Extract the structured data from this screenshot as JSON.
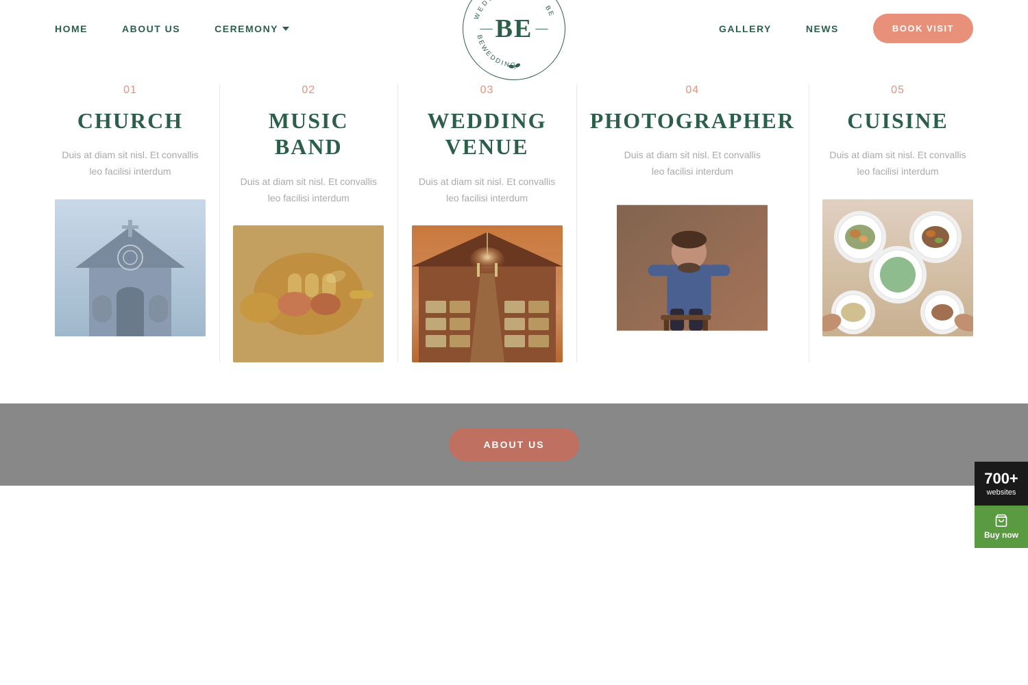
{
  "nav": {
    "home": "HOME",
    "about": "ABOUT US",
    "ceremony": "CEREMONY",
    "gallery": "GALLERY",
    "news": "NEWS",
    "book_btn": "BOOK VISIT"
  },
  "logo": {
    "be": "BE",
    "top_text": "WEDDING",
    "side_text": "BEWEDDING",
    "dash": "—",
    "circular_text": "BEWEDDING · BEWEDDING"
  },
  "services": [
    {
      "number": "01",
      "title": "CHURCH",
      "desc": "Duis at diam sit nisl. Et convallis leo facilisi interdum"
    },
    {
      "number": "02",
      "title_line1": "MUSIC",
      "title_line2": "BAND",
      "desc": "Duis at diam sit nisl. Et convallis leo facilisi interdum"
    },
    {
      "number": "03",
      "title_line1": "WEDDING",
      "title_line2": "VENUE",
      "desc": "Duis at diam sit nisl. Et convallis leo facilisi interdum"
    },
    {
      "number": "04",
      "title": "PHOTOGRAPHER",
      "desc": "Duis at diam sit nisl. Et convallis leo facilisi interdum"
    },
    {
      "number": "05",
      "title": "CUISINE",
      "desc": "Duis at diam sit nisl. Et convallis leo facilisi interdum"
    }
  ],
  "bottom": {
    "btn": "ABOUT US"
  },
  "widget": {
    "count": "700+",
    "label": "websites",
    "buy": "Buy now"
  },
  "colors": {
    "green": "#2c5f4a",
    "salmon": "#e8907a",
    "light_salmon": "#c07060",
    "gray_text": "#aaaaaa",
    "dark_bg": "#1a1a1a",
    "buy_green": "#5a9a40"
  }
}
